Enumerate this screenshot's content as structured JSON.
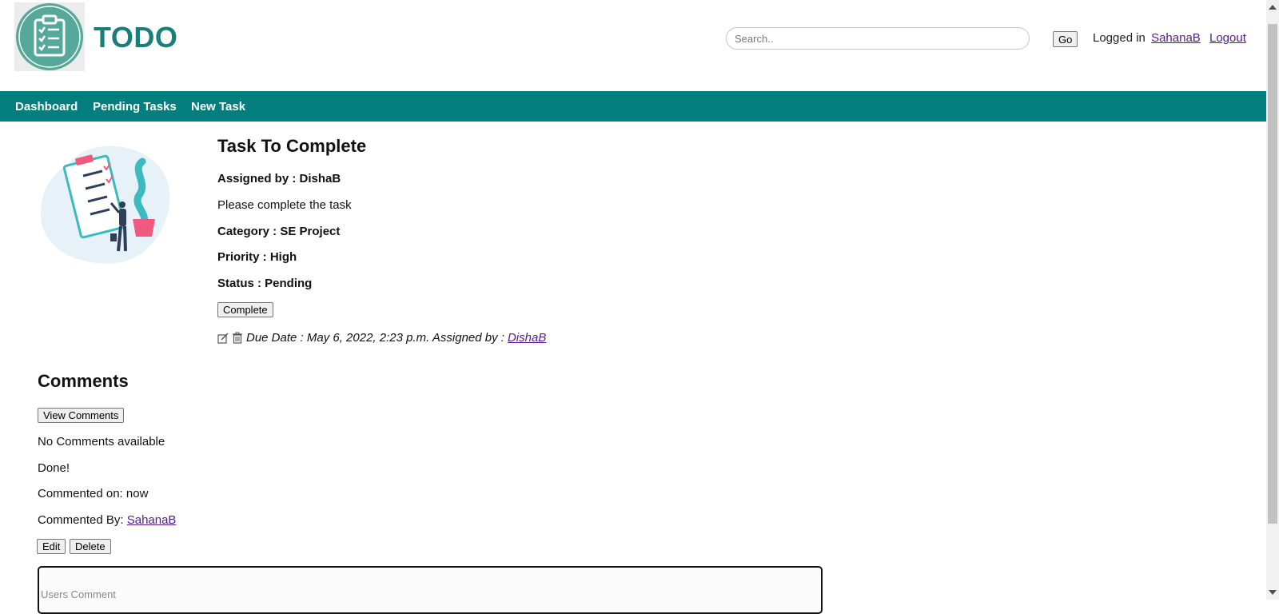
{
  "header": {
    "logo_text": "TODO",
    "search_placeholder": "Search..",
    "go_label": "Go",
    "logged_in_prefix": "Logged in",
    "username": "SahanaB",
    "logout_label": "Logout"
  },
  "nav": {
    "items": [
      {
        "label": "Dashboard"
      },
      {
        "label": "Pending Tasks"
      },
      {
        "label": "New Task"
      }
    ],
    "color": "#027e7e"
  },
  "task": {
    "title": "Task To Complete",
    "assigned_by_line": "Assigned by : DishaB",
    "description": "Please complete the task",
    "category_line": "Category : SE Project",
    "priority_line": "Priority : High",
    "status_line": "Status : Pending",
    "complete_button": "Complete",
    "due_text": "Due Date : May 6, 2022, 2:23 p.m. Assigned by :",
    "assigned_by_link": "DishaB"
  },
  "comments": {
    "heading": "Comments",
    "view_button": "View Comments",
    "none_text": "No Comments available",
    "comment_text": "Done!",
    "commented_on": "Commented on: now",
    "commented_by_prefix": "Commented By:",
    "commented_by_user": "SahanaB",
    "edit_button": "Edit",
    "delete_button": "Delete",
    "input_placeholder": "Users Comment"
  },
  "icons": {
    "logo": "clipboard-checklist-icon",
    "edit": "edit-icon",
    "delete": "trash-icon"
  },
  "colors": {
    "brand": "#1a7f78",
    "logo_circle": "#56a89a",
    "link": "#551a8b"
  }
}
